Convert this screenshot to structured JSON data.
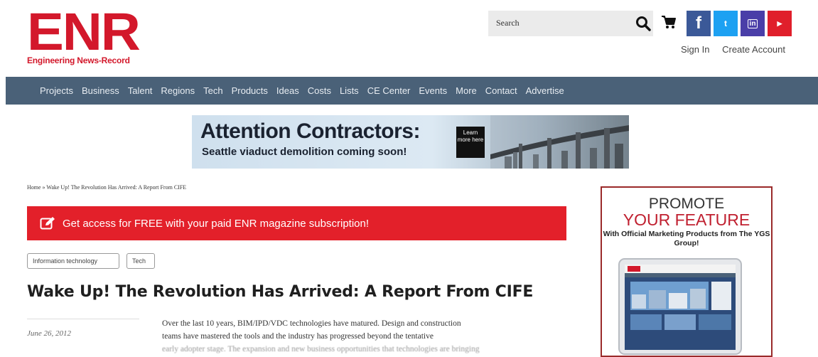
{
  "header": {
    "logo_mark": "ENR",
    "logo_sub": "Engineering News-Record",
    "search_placeholder": "Search",
    "social": {
      "facebook": "f",
      "twitter": "t",
      "linkedin": "in",
      "youtube": "▶"
    },
    "sign_in": "Sign In",
    "create_account": "Create Account"
  },
  "nav": {
    "items": [
      "Projects",
      "Business",
      "Talent",
      "Regions",
      "Tech",
      "Products",
      "Ideas",
      "Costs",
      "Lists",
      "CE Center",
      "Events",
      "More",
      "Contact",
      "Advertise"
    ]
  },
  "banner": {
    "title": "Attention Contractors:",
    "subtitle": "Seattle viaduct demolition coming soon!",
    "button": "Learn more here"
  },
  "breadcrumb": "Home » Wake Up! The Revolution Has Arrived: A Report From CIFE",
  "access_bar": {
    "text": "Get access for FREE with your paid ENR magazine subscription!"
  },
  "tags": [
    "Information technology",
    "Tech"
  ],
  "article": {
    "title": "Wake Up! The Revolution Has Arrived: A Report From CIFE",
    "date": "June 26, 2012",
    "body_lines": [
      "Over the last 10 years, BIM/IPD/VDC technologies have matured. Design and construction",
      "teams have mastered the tools and  the industry has progressed beyond the tentative",
      "early adopter stage. The expansion and new business opportunities that technologies are bringing"
    ]
  },
  "promo": {
    "line1": "PROMOTE",
    "line2": "YOUR FEATURE",
    "line3": "With Official Marketing Products from The YGS Group!"
  },
  "colors": {
    "brand_red": "#d3182b",
    "nav_bg": "#4a6178",
    "access_red": "#e3202a"
  }
}
